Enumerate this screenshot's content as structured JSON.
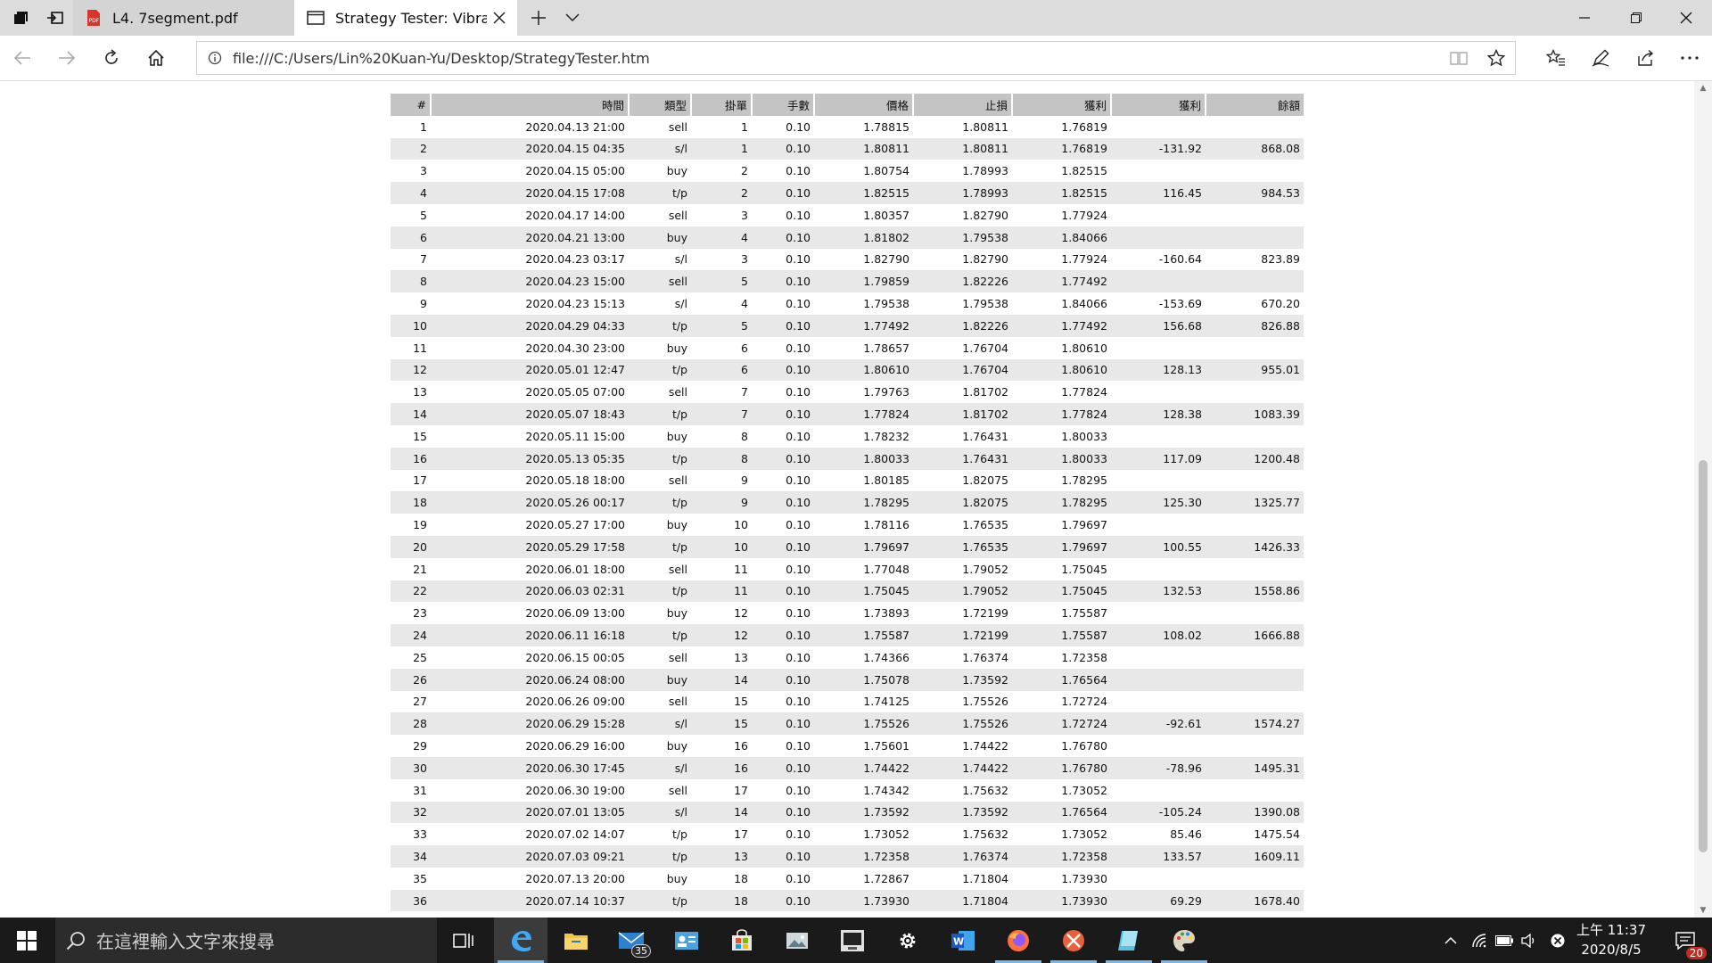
{
  "browser": {
    "tabs": [
      {
        "title": "L4. 7segment.pdf",
        "icon": "pdf-icon",
        "active": false
      },
      {
        "title": "Strategy Tester: Vibrant",
        "icon": "page-icon",
        "active": true
      }
    ],
    "address": "file:///C:/Users/Lin%20Kuan-Yu/Desktop/StrategyTester.htm"
  },
  "table": {
    "headers": [
      "#",
      "時間",
      "類型",
      "掛單",
      "手數",
      "價格",
      "止損",
      "獲利",
      "獲利",
      "餘額"
    ],
    "rows": [
      [
        "1",
        "2020.04.13 21:00",
        "sell",
        "1",
        "0.10",
        "1.78815",
        "1.80811",
        "1.76819",
        "",
        ""
      ],
      [
        "2",
        "2020.04.15 04:35",
        "s/l",
        "1",
        "0.10",
        "1.80811",
        "1.80811",
        "1.76819",
        "-131.92",
        "868.08"
      ],
      [
        "3",
        "2020.04.15 05:00",
        "buy",
        "2",
        "0.10",
        "1.80754",
        "1.78993",
        "1.82515",
        "",
        ""
      ],
      [
        "4",
        "2020.04.15 17:08",
        "t/p",
        "2",
        "0.10",
        "1.82515",
        "1.78993",
        "1.82515",
        "116.45",
        "984.53"
      ],
      [
        "5",
        "2020.04.17 14:00",
        "sell",
        "3",
        "0.10",
        "1.80357",
        "1.82790",
        "1.77924",
        "",
        ""
      ],
      [
        "6",
        "2020.04.21 13:00",
        "buy",
        "4",
        "0.10",
        "1.81802",
        "1.79538",
        "1.84066",
        "",
        ""
      ],
      [
        "7",
        "2020.04.23 03:17",
        "s/l",
        "3",
        "0.10",
        "1.82790",
        "1.82790",
        "1.77924",
        "-160.64",
        "823.89"
      ],
      [
        "8",
        "2020.04.23 15:00",
        "sell",
        "5",
        "0.10",
        "1.79859",
        "1.82226",
        "1.77492",
        "",
        ""
      ],
      [
        "9",
        "2020.04.23 15:13",
        "s/l",
        "4",
        "0.10",
        "1.79538",
        "1.79538",
        "1.84066",
        "-153.69",
        "670.20"
      ],
      [
        "10",
        "2020.04.29 04:33",
        "t/p",
        "5",
        "0.10",
        "1.77492",
        "1.82226",
        "1.77492",
        "156.68",
        "826.88"
      ],
      [
        "11",
        "2020.04.30 23:00",
        "buy",
        "6",
        "0.10",
        "1.78657",
        "1.76704",
        "1.80610",
        "",
        ""
      ],
      [
        "12",
        "2020.05.01 12:47",
        "t/p",
        "6",
        "0.10",
        "1.80610",
        "1.76704",
        "1.80610",
        "128.13",
        "955.01"
      ],
      [
        "13",
        "2020.05.05 07:00",
        "sell",
        "7",
        "0.10",
        "1.79763",
        "1.81702",
        "1.77824",
        "",
        ""
      ],
      [
        "14",
        "2020.05.07 18:43",
        "t/p",
        "7",
        "0.10",
        "1.77824",
        "1.81702",
        "1.77824",
        "128.38",
        "1083.39"
      ],
      [
        "15",
        "2020.05.11 15:00",
        "buy",
        "8",
        "0.10",
        "1.78232",
        "1.76431",
        "1.80033",
        "",
        ""
      ],
      [
        "16",
        "2020.05.13 05:35",
        "t/p",
        "8",
        "0.10",
        "1.80033",
        "1.76431",
        "1.80033",
        "117.09",
        "1200.48"
      ],
      [
        "17",
        "2020.05.18 18:00",
        "sell",
        "9",
        "0.10",
        "1.80185",
        "1.82075",
        "1.78295",
        "",
        ""
      ],
      [
        "18",
        "2020.05.26 00:17",
        "t/p",
        "9",
        "0.10",
        "1.78295",
        "1.82075",
        "1.78295",
        "125.30",
        "1325.77"
      ],
      [
        "19",
        "2020.05.27 17:00",
        "buy",
        "10",
        "0.10",
        "1.78116",
        "1.76535",
        "1.79697",
        "",
        ""
      ],
      [
        "20",
        "2020.05.29 17:58",
        "t/p",
        "10",
        "0.10",
        "1.79697",
        "1.76535",
        "1.79697",
        "100.55",
        "1426.33"
      ],
      [
        "21",
        "2020.06.01 18:00",
        "sell",
        "11",
        "0.10",
        "1.77048",
        "1.79052",
        "1.75045",
        "",
        ""
      ],
      [
        "22",
        "2020.06.03 02:31",
        "t/p",
        "11",
        "0.10",
        "1.75045",
        "1.79052",
        "1.75045",
        "132.53",
        "1558.86"
      ],
      [
        "23",
        "2020.06.09 13:00",
        "buy",
        "12",
        "0.10",
        "1.73893",
        "1.72199",
        "1.75587",
        "",
        ""
      ],
      [
        "24",
        "2020.06.11 16:18",
        "t/p",
        "12",
        "0.10",
        "1.75587",
        "1.72199",
        "1.75587",
        "108.02",
        "1666.88"
      ],
      [
        "25",
        "2020.06.15 00:05",
        "sell",
        "13",
        "0.10",
        "1.74366",
        "1.76374",
        "1.72358",
        "",
        ""
      ],
      [
        "26",
        "2020.06.24 08:00",
        "buy",
        "14",
        "0.10",
        "1.75078",
        "1.73592",
        "1.76564",
        "",
        ""
      ],
      [
        "27",
        "2020.06.26 09:00",
        "sell",
        "15",
        "0.10",
        "1.74125",
        "1.75526",
        "1.72724",
        "",
        ""
      ],
      [
        "28",
        "2020.06.29 15:28",
        "s/l",
        "15",
        "0.10",
        "1.75526",
        "1.75526",
        "1.72724",
        "-92.61",
        "1574.27"
      ],
      [
        "29",
        "2020.06.29 16:00",
        "buy",
        "16",
        "0.10",
        "1.75601",
        "1.74422",
        "1.76780",
        "",
        ""
      ],
      [
        "30",
        "2020.06.30 17:45",
        "s/l",
        "16",
        "0.10",
        "1.74422",
        "1.74422",
        "1.76780",
        "-78.96",
        "1495.31"
      ],
      [
        "31",
        "2020.06.30 19:00",
        "sell",
        "17",
        "0.10",
        "1.74342",
        "1.75632",
        "1.73052",
        "",
        ""
      ],
      [
        "32",
        "2020.07.01 13:05",
        "s/l",
        "14",
        "0.10",
        "1.73592",
        "1.73592",
        "1.76564",
        "-105.24",
        "1390.08"
      ],
      [
        "33",
        "2020.07.02 14:07",
        "t/p",
        "17",
        "0.10",
        "1.73052",
        "1.75632",
        "1.73052",
        "85.46",
        "1475.54"
      ],
      [
        "34",
        "2020.07.03 09:21",
        "t/p",
        "13",
        "0.10",
        "1.72358",
        "1.76374",
        "1.72358",
        "133.57",
        "1609.11"
      ],
      [
        "35",
        "2020.07.13 20:00",
        "buy",
        "18",
        "0.10",
        "1.72867",
        "1.71804",
        "1.73930",
        "",
        ""
      ],
      [
        "36",
        "2020.07.14 10:37",
        "t/p",
        "18",
        "0.10",
        "1.73930",
        "1.71804",
        "1.73930",
        "69.29",
        "1678.40"
      ]
    ]
  },
  "taskbar": {
    "search_placeholder": "在這裡輸入文字來搜尋",
    "mail_badge": "35",
    "clock_time": "上午 11:37",
    "clock_date": "2020/8/5",
    "notification_count": "20"
  },
  "colors": {
    "header_bg": "#c4c4c4",
    "row_alt_bg": "#e8e8e8",
    "taskbar_bg": "#1a1a1a",
    "accent": "#76b9ed"
  }
}
